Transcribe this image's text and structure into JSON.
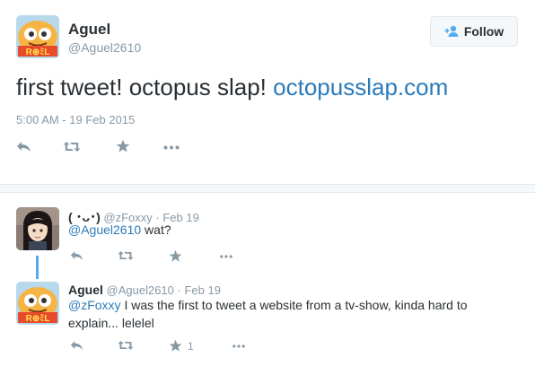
{
  "main_tweet": {
    "name": "Aguel",
    "handle": "@Aguel2610",
    "follow_label": "Follow",
    "text_plain": "first tweet! octopus slap! ",
    "text_link": "octopusslap.com",
    "timestamp": "5:00 AM - 19 Feb 2015",
    "actions": [
      "reply-icon",
      "retweet-icon",
      "favorite-icon",
      "more-icon"
    ]
  },
  "replies": [
    {
      "name": "( ･ᴗ･)",
      "handle": "@zFoxxy",
      "date": "· Feb 19",
      "mention": "@Aguel2610",
      "text": " wat?",
      "favorite_count": ""
    },
    {
      "name": "Aguel",
      "handle": "@Aguel2610",
      "date": "· Feb 19",
      "mention": "@zFoxxy",
      "text": " I was the first to tweet a website from a tv-show, kinda hard to explain... lelelel",
      "favorite_count": "1"
    }
  ],
  "colors": {
    "link": "#2b7bb9",
    "muted": "#8899a6",
    "thread": "#55acee"
  }
}
